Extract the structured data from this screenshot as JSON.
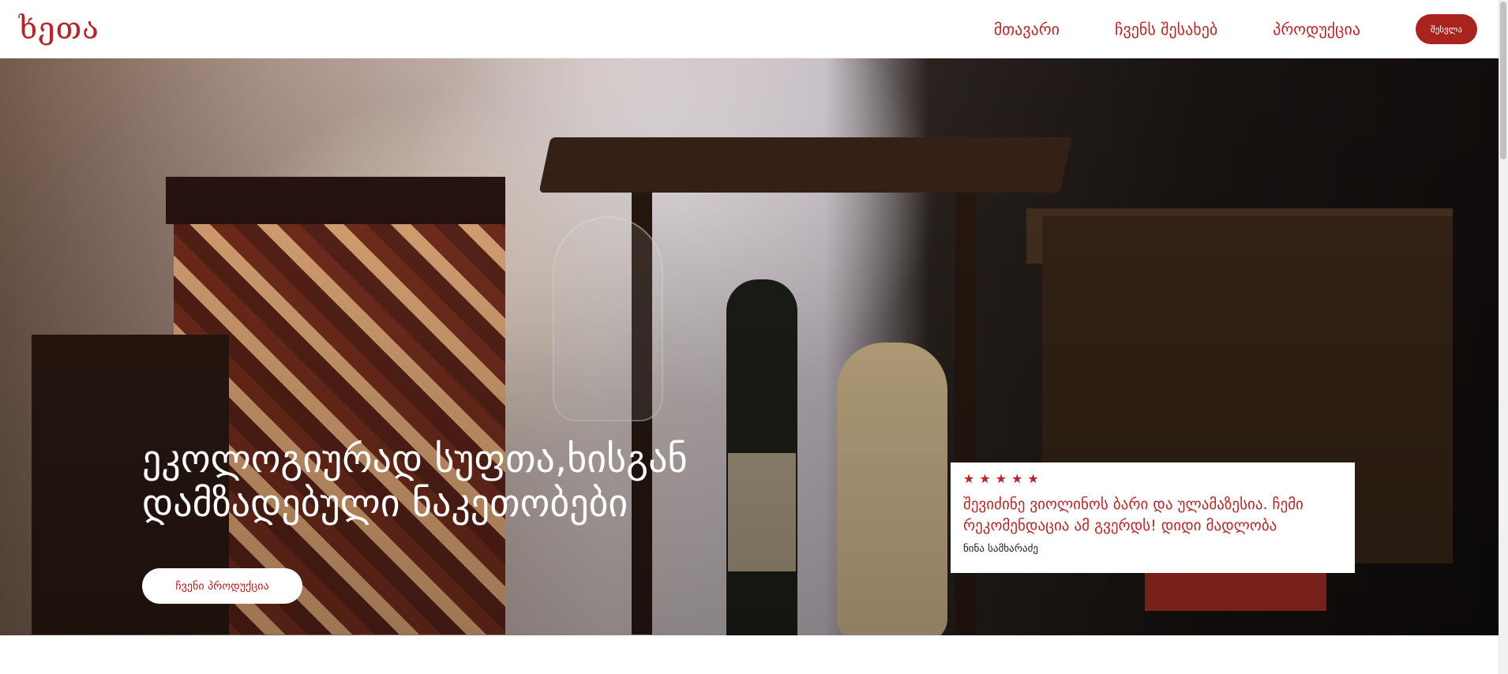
{
  "header": {
    "logo": "ხეთა",
    "nav": [
      "მთავარი",
      "ჩვენს შესახებ",
      "პროდუქცია"
    ],
    "login_label": "შესვლა"
  },
  "hero": {
    "title": "ეკოლოგიურად სუფთა,ხისგან დამზადებული ნაკეთობები",
    "button_label": "ჩვენი პროდუქცია"
  },
  "review": {
    "stars": "★★★★★",
    "rating": 5,
    "text": "შევიძინე ვიოლინოს ბარი და ულამაზესია. ჩემი რეკომენდაცია ამ გვერდს! დიდი მადლობა",
    "author": "ნინა სამხარაძე"
  },
  "colors": {
    "accent": "#b0282a",
    "button_bg": "#a9231f",
    "text_dark": "#1b1b1b",
    "white": "#ffffff"
  }
}
